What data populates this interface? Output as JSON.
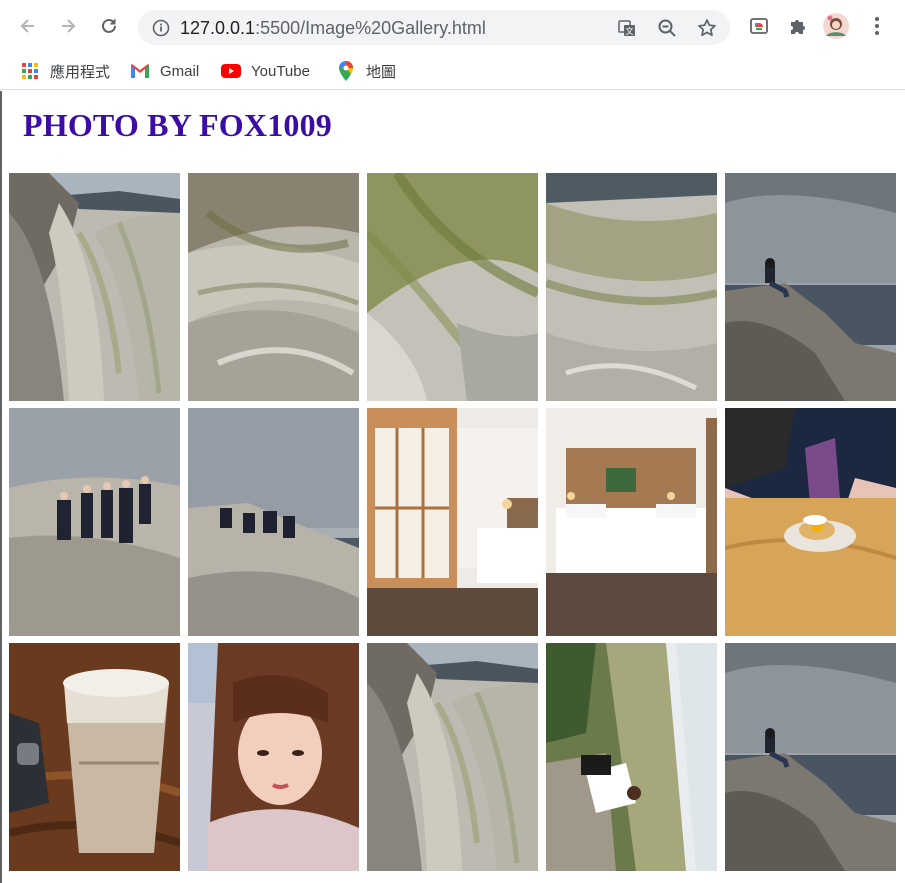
{
  "browser": {
    "url_host": "127.0.0.1",
    "url_rest": ":5500/Image%20Gallery.html",
    "bookmarks": [
      {
        "label": "應用程式",
        "icon": "apps-grid-icon"
      },
      {
        "label": "Gmail",
        "icon": "gmail-icon"
      },
      {
        "label": "YouTube",
        "icon": "youtube-icon"
      },
      {
        "label": "地圖",
        "icon": "maps-pin-icon"
      }
    ]
  },
  "page": {
    "title": "PHOTO BY FOX1009"
  },
  "gallery": {
    "photos": [
      {
        "subject": "rock-coast"
      },
      {
        "subject": "rock-closeup"
      },
      {
        "subject": "moss-rock"
      },
      {
        "subject": "rock-closeup-2"
      },
      {
        "subject": "person-sea"
      },
      {
        "subject": "group-rocks"
      },
      {
        "subject": "group-rocks-2"
      },
      {
        "subject": "hotel-room"
      },
      {
        "subject": "hotel-bed"
      },
      {
        "subject": "dessert-table"
      },
      {
        "subject": "coffee-cup"
      },
      {
        "subject": "portrait"
      },
      {
        "subject": "rock-coast-2"
      },
      {
        "subject": "hillside-person"
      },
      {
        "subject": "person-sea-2"
      }
    ]
  },
  "colors": {
    "title": "#3b0ca6",
    "chrome_icon": "#5f6368",
    "omnibox_bg": "#f1f3f4"
  }
}
